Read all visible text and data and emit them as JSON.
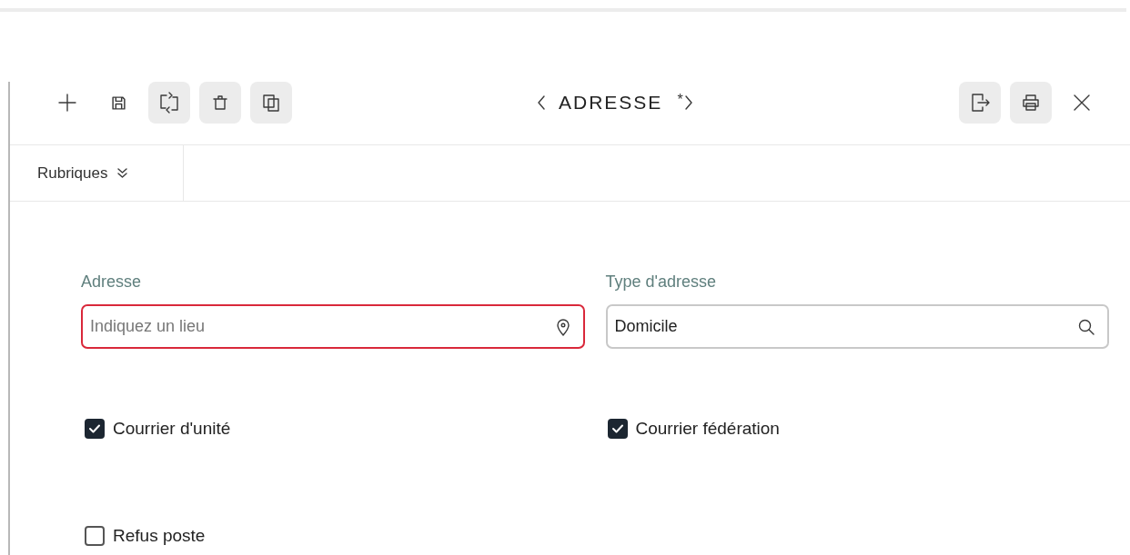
{
  "toolbar": {
    "left_buttons": [
      {
        "highlighted": false
      },
      {
        "highlighted": false
      },
      {
        "highlighted": true
      },
      {
        "highlighted": true
      },
      {
        "highlighted": true
      }
    ],
    "title": "ADRESSE",
    "modified_mark": "*",
    "right_buttons": [
      {
        "highlighted": true
      },
      {
        "highlighted": true
      },
      {
        "highlighted": false
      }
    ]
  },
  "sections_menu": {
    "label": "Rubriques"
  },
  "fields": [
    {
      "label": "Adresse",
      "placeholder": "Indiquez un lieu",
      "invalid": true,
      "kind": "location"
    },
    {
      "label": "Type d'adresse",
      "value": "Domicile",
      "invalid": false,
      "kind": "search"
    }
  ],
  "checkboxes": [
    {
      "label": "Courrier d'unité",
      "checked": true
    },
    {
      "label": "Courrier fédération",
      "checked": true
    },
    {
      "label": "Refus poste",
      "checked": false
    }
  ]
}
